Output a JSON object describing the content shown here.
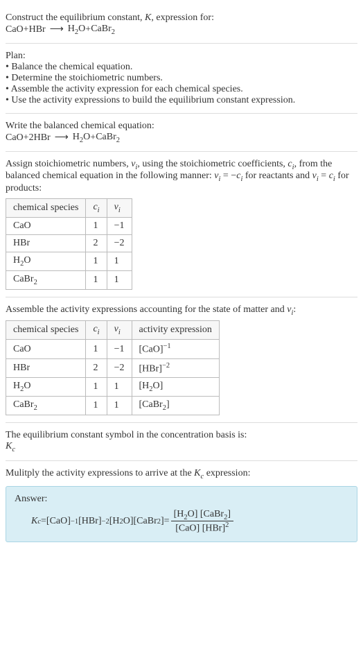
{
  "intro": {
    "line1_a": "Construct the equilibrium constant, ",
    "line1_K": "K",
    "line1_b": ", expression for:",
    "eq_lhs1": "CaO",
    "eq_plus": " + ",
    "eq_lhs2": "HBr",
    "eq_rhs1": "H",
    "eq_rhs1_sub": "2",
    "eq_rhs1b": "O",
    "eq_rhs2": "CaBr",
    "eq_rhs2_sub": "2"
  },
  "plan": {
    "title": "Plan:",
    "b1": "• Balance the chemical equation.",
    "b2": "• Determine the stoichiometric numbers.",
    "b3": "• Assemble the activity expression for each chemical species.",
    "b4": "• Use the activity expressions to build the equilibrium constant expression."
  },
  "balanced": {
    "title": "Write the balanced chemical equation:",
    "lhs1": "CaO",
    "plus": " + ",
    "coef2": "2 ",
    "lhs2": "HBr",
    "rhs1": "H",
    "rhs1_sub": "2",
    "rhs1b": "O",
    "rhs2": "CaBr",
    "rhs2_sub": "2"
  },
  "stoich": {
    "text_a": "Assign stoichiometric numbers, ",
    "nu": "ν",
    "sub_i": "i",
    "text_b": ", using the stoichiometric coefficients, ",
    "c": "c",
    "text_c": ", from the balanced chemical equation in the following manner: ",
    "rel1_a": "ν",
    "rel1_b": " = −",
    "rel1_c": "c",
    "text_d": " for reactants and ",
    "rel2_a": "ν",
    "rel2_b": " = ",
    "rel2_c": "c",
    "text_e": " for products:",
    "h1": "chemical species",
    "h2_a": "c",
    "h2_b": "i",
    "h3_a": "ν",
    "h3_b": "i",
    "rows": [
      {
        "sp_a": "CaO",
        "sp_sub": "",
        "c": "1",
        "nu": "−1"
      },
      {
        "sp_a": "HBr",
        "sp_sub": "",
        "c": "2",
        "nu": "−2"
      },
      {
        "sp_a": "H",
        "sp_sub": "2",
        "sp_b": "O",
        "c": "1",
        "nu": "1"
      },
      {
        "sp_a": "CaBr",
        "sp_sub": "2",
        "sp_b": "",
        "c": "1",
        "nu": "1"
      }
    ]
  },
  "activity": {
    "text_a": "Assemble the activity expressions accounting for the state of matter and ",
    "nu": "ν",
    "sub_i": "i",
    "text_b": ":",
    "h1": "chemical species",
    "h2_a": "c",
    "h2_b": "i",
    "h3_a": "ν",
    "h3_b": "i",
    "h4": "activity expression",
    "rows": [
      {
        "sp_a": "CaO",
        "sp_sub": "",
        "sp_b": "",
        "c": "1",
        "nu": "−1",
        "ae_a": "[CaO]",
        "ae_sup": "−1",
        "ae_b": ""
      },
      {
        "sp_a": "HBr",
        "sp_sub": "",
        "sp_b": "",
        "c": "2",
        "nu": "−2",
        "ae_a": "[HBr]",
        "ae_sup": "−2",
        "ae_b": ""
      },
      {
        "sp_a": "H",
        "sp_sub": "2",
        "sp_b": "O",
        "c": "1",
        "nu": "1",
        "ae_a": "[H",
        "ae_sub": "2",
        "ae_b": "O]"
      },
      {
        "sp_a": "CaBr",
        "sp_sub": "2",
        "sp_b": "",
        "c": "1",
        "nu": "1",
        "ae_a": "[CaBr",
        "ae_sub": "2",
        "ae_b": "]"
      }
    ]
  },
  "ksymbol": {
    "line1": "The equilibrium constant symbol in the concentration basis is:",
    "K": "K",
    "sub": "c"
  },
  "final": {
    "line1_a": "Mulitply the activity expressions to arrive at the ",
    "K": "K",
    "sub": "c",
    "line1_b": " expression:",
    "answer": "Answer:",
    "Kc_K": "K",
    "Kc_sub": "c",
    "eq": " = ",
    "t1": "[CaO]",
    "t1_sup": "−1",
    "sp": " ",
    "t2": "[HBr]",
    "t2_sup": "−2",
    "t3a": "[H",
    "t3sub": "2",
    "t3b": "O]",
    "t4a": "[CaBr",
    "t4sub": "2",
    "t4b": "]",
    "eq2": " = ",
    "num_a": "[H",
    "num_asub": "2",
    "num_b": "O] [CaBr",
    "num_bsub": "2",
    "num_c": "]",
    "den_a": "[CaO] [HBr]",
    "den_sup": "2"
  },
  "arrow": "⟶"
}
